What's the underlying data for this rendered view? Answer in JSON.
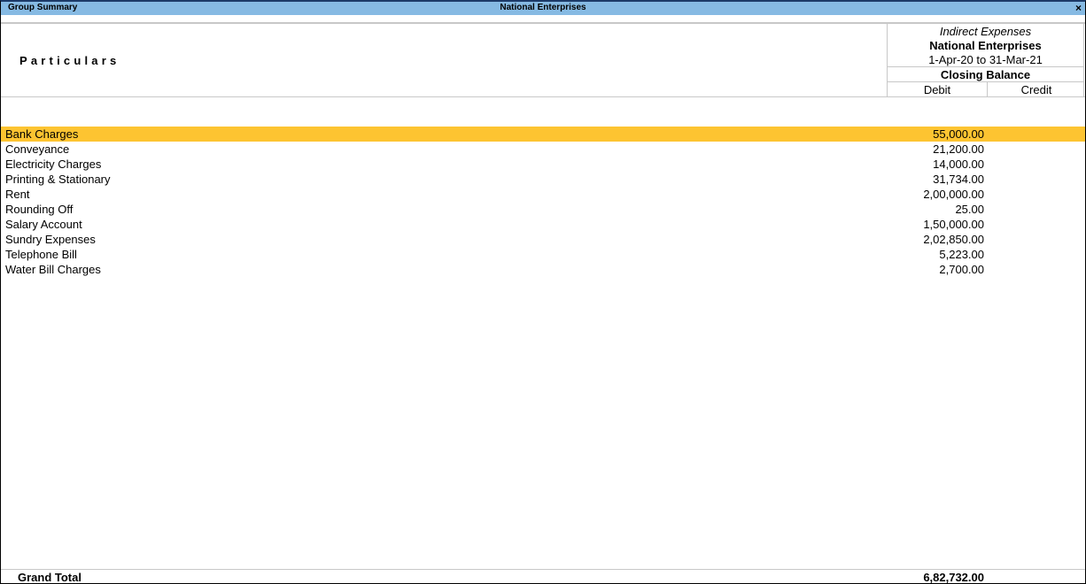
{
  "titlebar": {
    "left_title": "Group Summary",
    "center_title": "National Enterprises",
    "close_icon": "×"
  },
  "header": {
    "particulars_label": "Particulars",
    "column": {
      "group_name": "Indirect Expenses",
      "company": "National Enterprises",
      "period": "1-Apr-20 to 31-Mar-21",
      "balance_type": "Closing Balance",
      "debit_label": "Debit",
      "credit_label": "Credit"
    }
  },
  "rows": [
    {
      "name": "Bank Charges",
      "debit": "55,000.00",
      "credit": "",
      "selected": true
    },
    {
      "name": "Conveyance",
      "debit": "21,200.00",
      "credit": ""
    },
    {
      "name": "Electricity Charges",
      "debit": "14,000.00",
      "credit": ""
    },
    {
      "name": "Printing & Stationary",
      "debit": "31,734.00",
      "credit": ""
    },
    {
      "name": "Rent",
      "debit": "2,00,000.00",
      "credit": ""
    },
    {
      "name": "Rounding Off",
      "debit": "25.00",
      "credit": ""
    },
    {
      "name": "Salary Account",
      "debit": "1,50,000.00",
      "credit": ""
    },
    {
      "name": "Sundry Expenses",
      "debit": "2,02,850.00",
      "credit": ""
    },
    {
      "name": "Telephone Bill",
      "debit": "5,223.00",
      "credit": ""
    },
    {
      "name": "Water Bill Charges",
      "debit": "2,700.00",
      "credit": ""
    }
  ],
  "footer": {
    "grand_total_label": "Grand Total",
    "grand_total_debit": "6,82,732.00"
  },
  "colors": {
    "titlebar_bg": "#86bae3",
    "selected_row_bg": "#fdc431"
  }
}
